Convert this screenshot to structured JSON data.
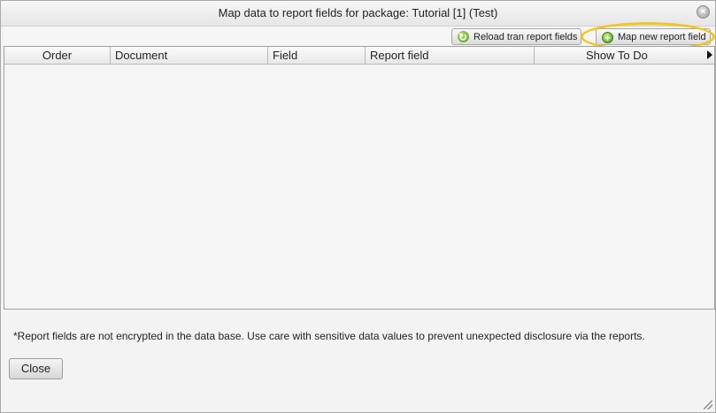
{
  "dialog": {
    "title": "Map data to report fields for package: Tutorial [1] (Test)",
    "close_icon": "close-circle-icon"
  },
  "toolbar": {
    "reload_label": "Reload tran report fields",
    "reload_icon": "refresh-icon",
    "map_label": "Map new report field",
    "map_icon": "add-circle-icon",
    "highlight_color": "#f4c51b"
  },
  "grid": {
    "columns": [
      "Order",
      "Document",
      "Field",
      "Report field",
      "Show To Do"
    ],
    "rows": []
  },
  "footer": {
    "notice": "*Report fields are not encrypted in the data base. Use care with sensitive data values to prevent unexpected disclosure via the reports.",
    "close_label": "Close"
  }
}
